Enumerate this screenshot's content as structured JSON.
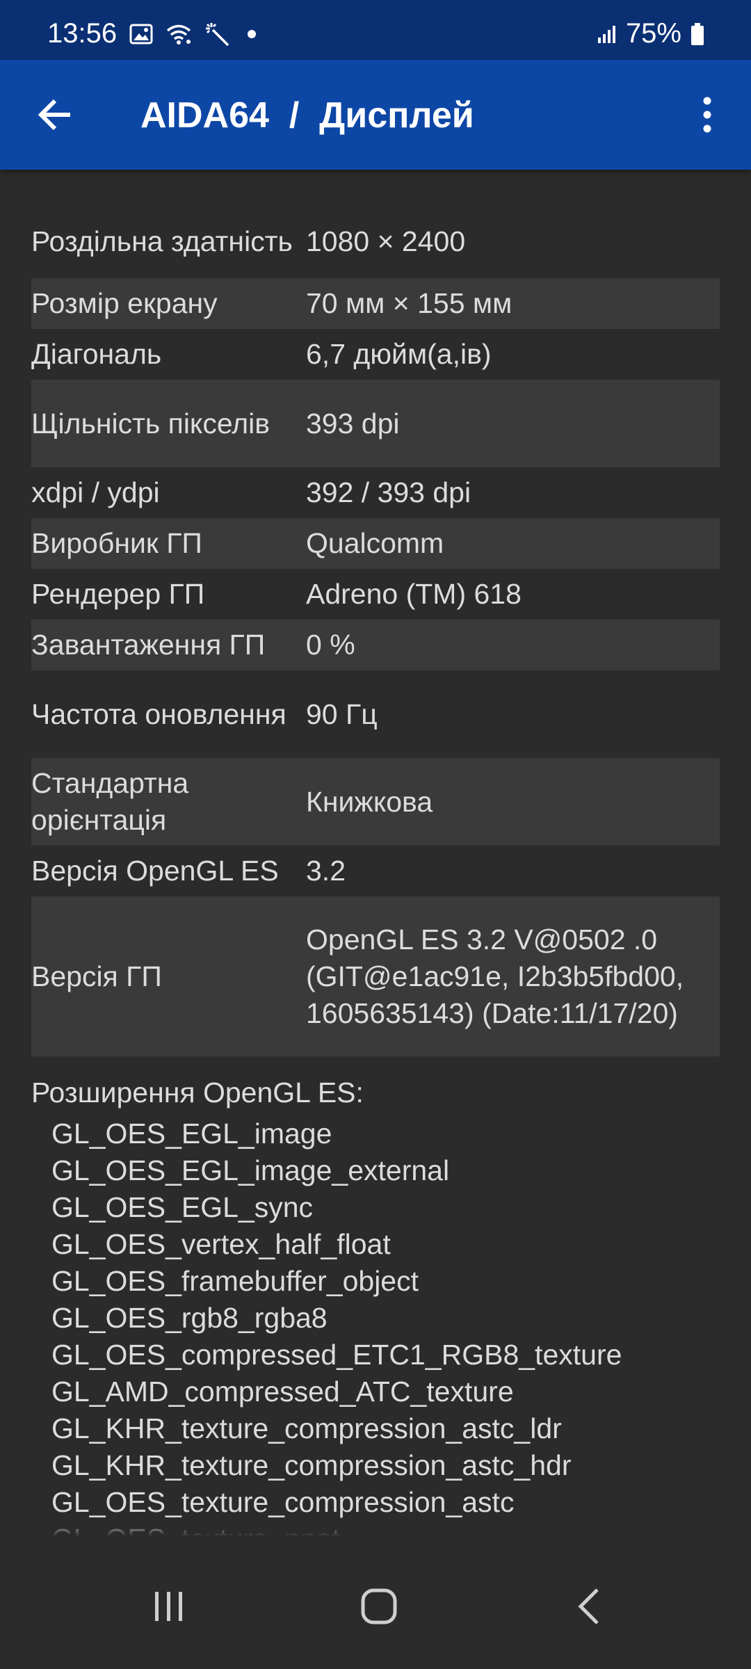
{
  "status_bar": {
    "time": "13:56",
    "battery": "75%",
    "icons": [
      "image-icon",
      "wifi-icon",
      "magic-wand-icon",
      "dot-icon",
      "signal-icon",
      "battery-icon"
    ]
  },
  "app_bar": {
    "title": "AIDA64  /  Дисплей",
    "back_icon": "arrow-left-icon",
    "menu_icon": "more-vert-icon",
    "color": "#0d47a6"
  },
  "info_rows": [
    {
      "label": "Роздільна здатність",
      "value": "1080 × 2400"
    },
    {
      "label": "Розмір екрану",
      "value": "70 мм × 155 мм"
    },
    {
      "label": "Діагональ",
      "value": "6,7 дюйм(а,ів)"
    },
    {
      "label": "Щільність пікселів",
      "value": "393 dpi"
    },
    {
      "label": "xdpi / ydpi",
      "value": "392 / 393 dpi"
    },
    {
      "label": "Виробник ГП",
      "value": "Qualcomm"
    },
    {
      "label": "Рендерер ГП",
      "value": "Adreno (TM) 618"
    },
    {
      "label": "Завантаження ГП",
      "value": "0 %"
    },
    {
      "label": "Частота оновлення",
      "value": "90 Гц"
    },
    {
      "label": "Стандартна орієнтація",
      "value": "Книжкова"
    },
    {
      "label": "Версія OpenGL ES",
      "value": "3.2"
    },
    {
      "label": "Версія ГП",
      "value": "OpenGL ES 3.2 V@0502 .0 (GIT@e1ac91e, I2b3b5fbd00, 1605635143) (Date:11/17/20)"
    }
  ],
  "extensions": {
    "title": "Розширення OpenGL ES:",
    "items": [
      "GL_OES_EGL_image",
      "GL_OES_EGL_image_external",
      "GL_OES_EGL_sync",
      "GL_OES_vertex_half_float",
      "GL_OES_framebuffer_object",
      "GL_OES_rgb8_rgba8",
      "GL_OES_compressed_ETC1_RGB8_texture",
      "GL_AMD_compressed_ATC_texture",
      "GL_KHR_texture_compression_astc_ldr",
      "GL_KHR_texture_compression_astc_hdr",
      "GL_OES_texture_compression_astc",
      "GL_OES_texture_npot"
    ]
  },
  "nav_bar": {
    "icons": [
      "recent-apps-icon",
      "home-icon",
      "back-icon"
    ]
  }
}
